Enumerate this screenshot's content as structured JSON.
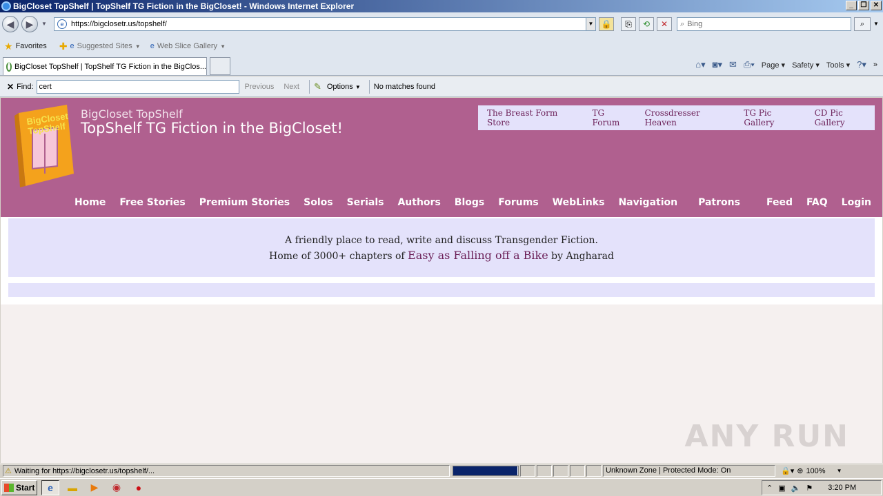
{
  "window": {
    "title": "BigCloset TopShelf | TopShelf TG Fiction in the BigCloset! - Windows Internet Explorer",
    "controls": {
      "minimize": "_",
      "restore": "❐",
      "close": "✕"
    }
  },
  "address": {
    "url": "https://bigclosetr.us/topshelf/",
    "search_placeholder": "Bing"
  },
  "favorites_bar": {
    "favorites": "Favorites",
    "suggested": "Suggested Sites",
    "webslice": "Web Slice Gallery"
  },
  "tab": {
    "title": "BigCloset TopShelf | TopShelf TG Fiction in the BigClos..."
  },
  "command_bar": {
    "page": "Page",
    "safety": "Safety",
    "tools": "Tools"
  },
  "find_bar": {
    "label": "Find:",
    "value": "cert",
    "previous": "Previous",
    "next": "Next",
    "options": "Options",
    "result": "No matches found"
  },
  "site": {
    "subtitle": "BigCloset TopShelf",
    "title": "TopShelf TG Fiction in the BigCloset!",
    "logo_text": "BigCloset TopShelf",
    "top_links": [
      "The Breast Form Store",
      "TG Forum",
      "Crossdresser Heaven",
      "TG Pic Gallery",
      "CD Pic Gallery"
    ],
    "nav": [
      "Home",
      "Free Stories",
      "Premium Stories",
      "Solos",
      "Serials",
      "Authors",
      "Blogs",
      "Forums",
      "WebLinks",
      "Navigation",
      "Patrons",
      "Feed",
      "FAQ",
      "Login"
    ],
    "intro_line1": "A friendly place to read, write and discuss Transgender Fiction.",
    "intro_line2_pre": "Home of 3000+ chapters of ",
    "intro_feature": "Easy as Falling off a Bike",
    "intro_line2_post": " by Angharad",
    "watermark": "ANY RUN"
  },
  "status": {
    "text": "Waiting for https://bigclosetr.us/topshelf/...",
    "zone": "Unknown Zone | Protected Mode: On",
    "zoom": "100%",
    "progress": 0.99
  },
  "taskbar": {
    "start": "Start",
    "clock": "3:20 PM"
  }
}
